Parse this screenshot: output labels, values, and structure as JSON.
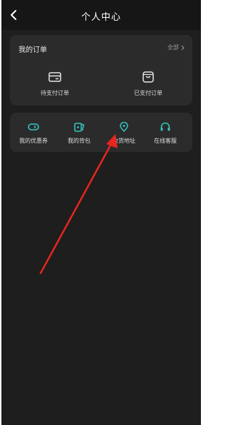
{
  "header": {
    "title": "个人中心"
  },
  "orders": {
    "heading": "我的订单",
    "all_label": "全部",
    "items": [
      {
        "label": "待支付订单",
        "icon": "wallet-icon"
      },
      {
        "label": "已支付订单",
        "icon": "bag-icon"
      }
    ]
  },
  "services": {
    "items": [
      {
        "label": "我的优惠券",
        "icon": "coupon-icon"
      },
      {
        "label": "我的背包",
        "icon": "cards-icon"
      },
      {
        "label": "收货地址",
        "icon": "location-pin-icon"
      },
      {
        "label": "在线客服",
        "icon": "headset-icon"
      }
    ]
  },
  "colors": {
    "accent": "#35c3bd",
    "arrow": "#e8251f",
    "background": "#1e1e1e",
    "card": "#2b2b2b"
  }
}
